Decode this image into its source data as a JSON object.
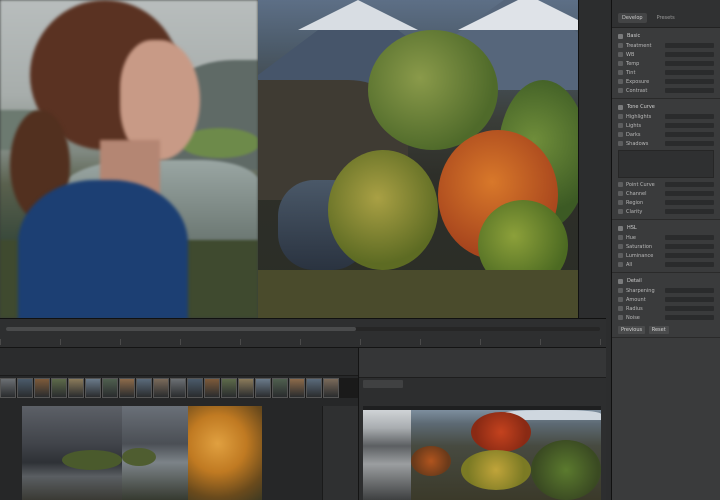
{
  "sidebar": {
    "tabs": [
      "Develop",
      "Presets"
    ],
    "sections": [
      {
        "header": "Basic",
        "rows": [
          "Treatment",
          "WB",
          "Temp",
          "Tint",
          "Exposure",
          "Contrast"
        ]
      },
      {
        "header": "Tone Curve",
        "rows": [
          "Highlights",
          "Lights",
          "Darks",
          "Shadows",
          "Point Curve",
          "Channel",
          "Region",
          "Clarity"
        ]
      },
      {
        "header": "HSL",
        "rows": [
          "Hue",
          "Saturation",
          "Luminance",
          "All"
        ]
      },
      {
        "header": "Detail",
        "rows": [
          "Sharpening",
          "Amount",
          "Radius",
          "Noise"
        ]
      }
    ],
    "buttons": [
      "Previous",
      "Reset"
    ]
  },
  "colors": {
    "panel_bg": "#3a3b3c",
    "app_bg": "#1b1b1c",
    "accent": "#4a4b4c"
  },
  "icons": [
    "gear-icon",
    "eye-icon",
    "collapse-icon",
    "checkbox-icon"
  ],
  "filmstrip": {
    "thumbnail_count": 20
  }
}
